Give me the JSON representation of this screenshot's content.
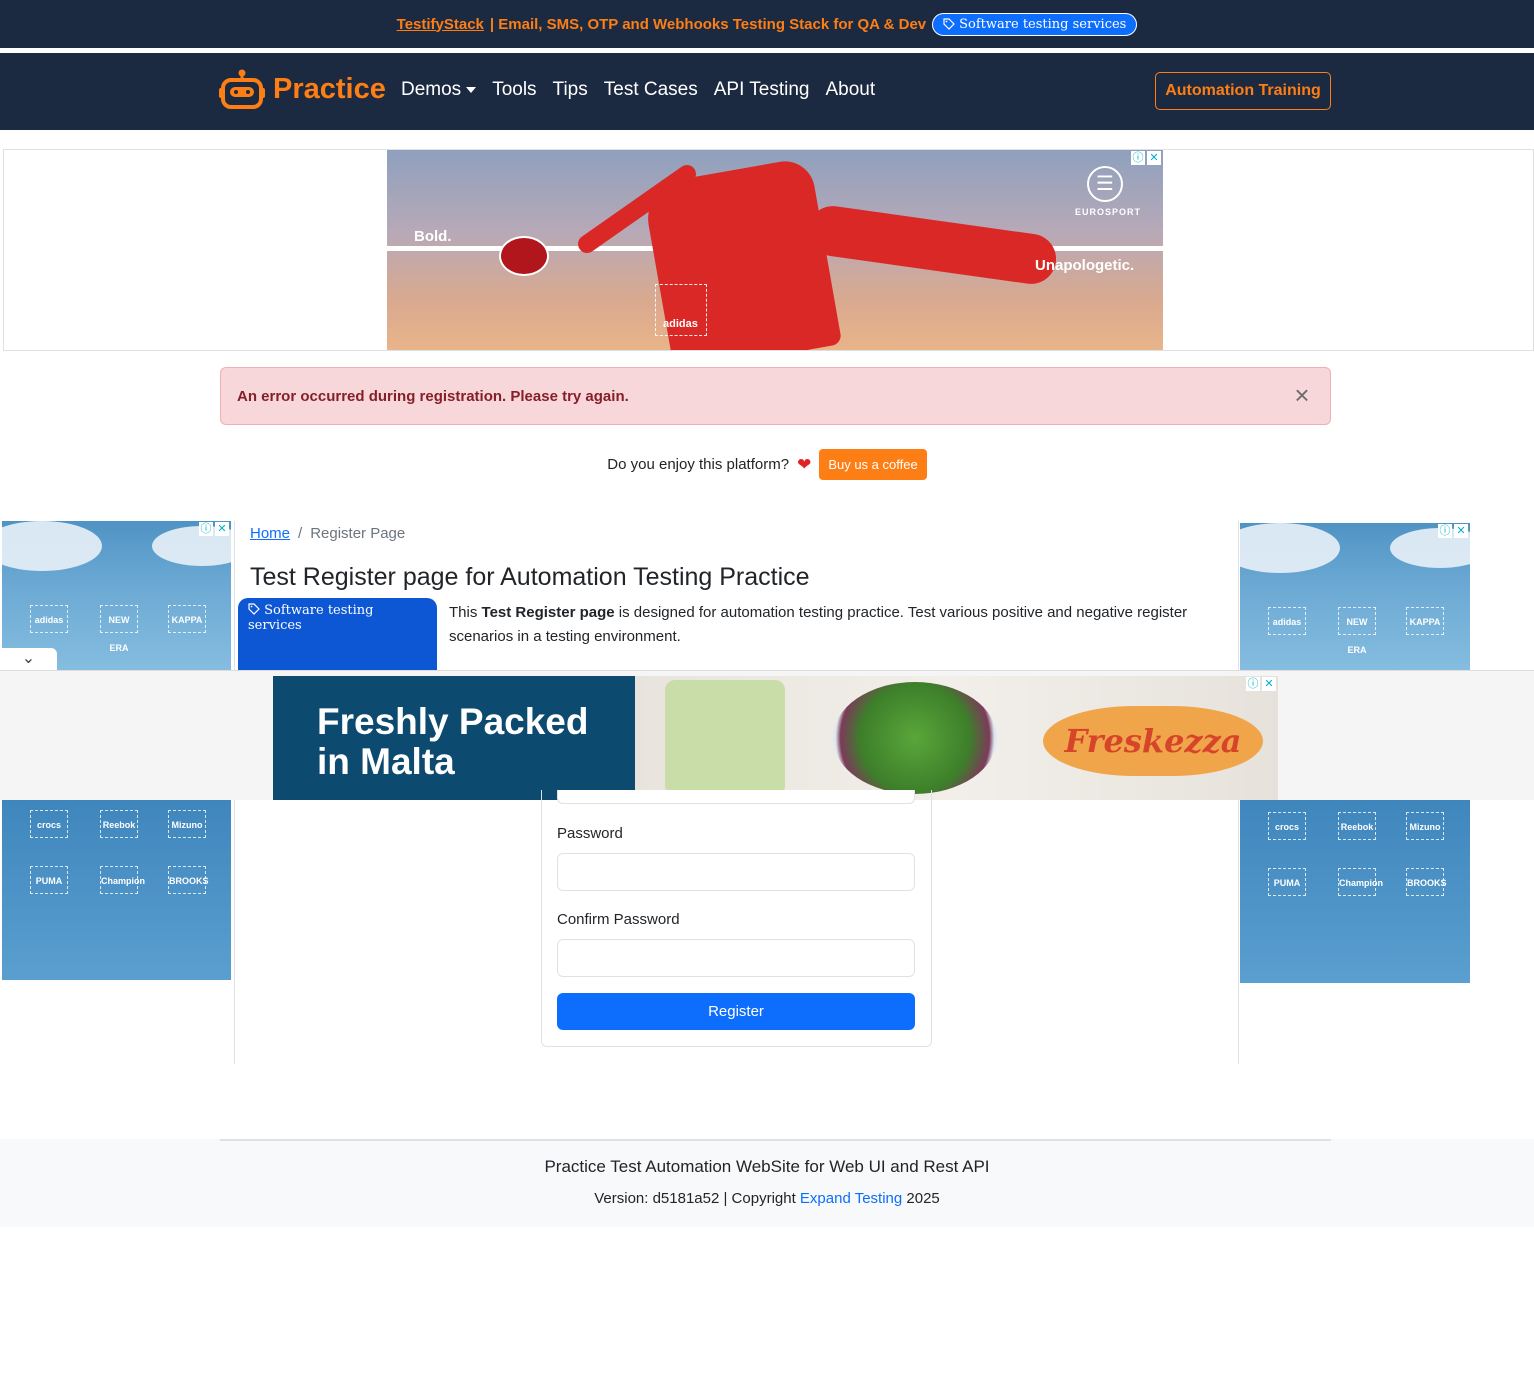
{
  "promo": {
    "link": "TestifyStack",
    "text": "| Email, SMS, OTP and Webhooks Testing Stack for QA & Dev",
    "pill": "Software testing services"
  },
  "navbar": {
    "brand": "Practice",
    "links": [
      "Demos",
      "Tools",
      "Tips",
      "Test Cases",
      "API Testing",
      "About"
    ],
    "training_button": "Automation Training"
  },
  "top_ad": {
    "left_text": "Bold.",
    "right_text": "Unapologetic.",
    "brand": "adidas",
    "sponsor": "EUROSPORT"
  },
  "alert": {
    "message": "An error occurred during registration. Please try again.",
    "close": "×"
  },
  "enjoy": {
    "text": "Do you enjoy this platform?",
    "heart": "❤",
    "button": "Buy us a coffee"
  },
  "breadcrumb": {
    "home": "Home",
    "separator": "/",
    "current": "Register Page"
  },
  "page": {
    "title": "Test Register page for Automation Testing Practice",
    "badge": "Software testing services",
    "desc_prefix": "This ",
    "desc_bold": "Test Register page",
    "desc_suffix": " is designed for automation testing practice. Test various positive and negative register scenarios in a testing environment."
  },
  "sticky_ad": {
    "headline_1": "Freshly Packed",
    "headline_2": "in Malta",
    "brand": "Freskezza"
  },
  "side_ad_logos_top": [
    "adidas",
    "NEW ERA",
    "KAPPA"
  ],
  "side_ad_logos_bottom": [
    "crocs",
    "Reebok",
    "Mizuno",
    "PUMA",
    "Champion",
    "BROOKS"
  ],
  "form": {
    "password_label": "Password",
    "confirm_label": "Confirm Password",
    "register_button": "Register"
  },
  "footer": {
    "title": "Practice Test Automation WebSite for Web UI and Rest API",
    "version_prefix": "Version: d5181a52 | Copyright ",
    "company": "Expand Testing",
    "year": " 2025"
  },
  "colors": {
    "navy": "#1b2a41",
    "orange": "#fd7e14",
    "primary": "#0d6efd",
    "alert_bg": "#f8d7da",
    "alert_text": "#842029"
  }
}
